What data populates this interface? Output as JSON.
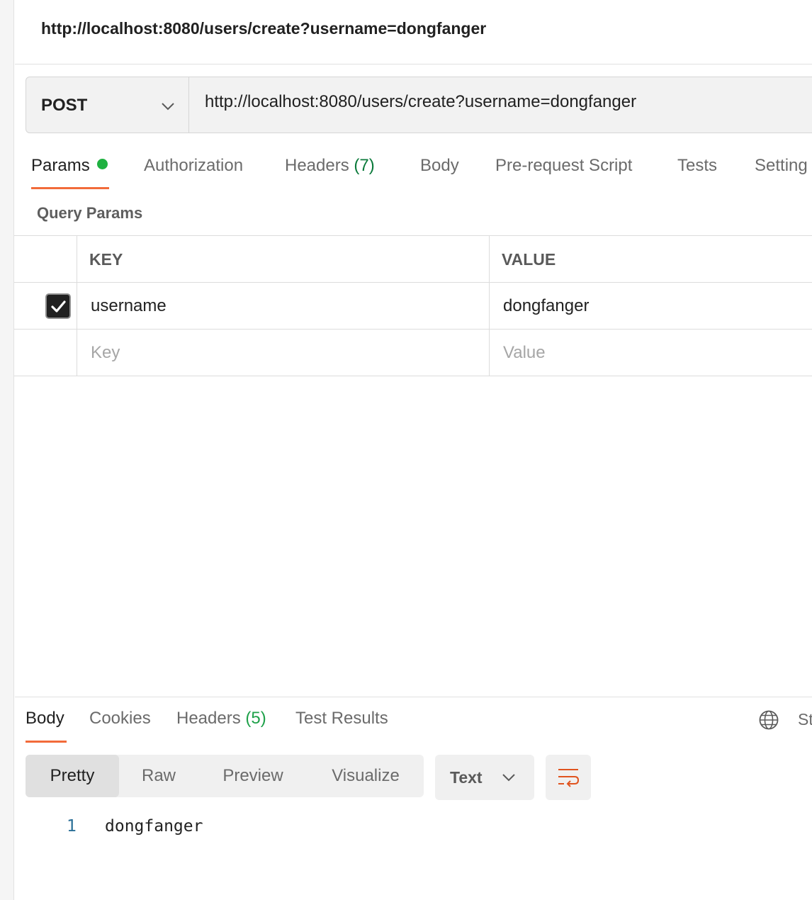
{
  "request": {
    "title": "http://localhost:8080/users/create?username=dongfanger",
    "method": "POST",
    "url": "http://localhost:8080/users/create?username=dongfanger"
  },
  "request_tabs": [
    {
      "label": "Params",
      "active": true,
      "has_indicator": true
    },
    {
      "label": "Authorization"
    },
    {
      "label": "Headers",
      "count": "(7)"
    },
    {
      "label": "Body"
    },
    {
      "label": "Pre-request Script"
    },
    {
      "label": "Tests"
    },
    {
      "label": "Setting"
    }
  ],
  "params": {
    "section_title": "Query Params",
    "columns": {
      "key": "KEY",
      "value": "VALUE"
    },
    "rows": [
      {
        "checked": true,
        "key": "username",
        "value": "dongfanger"
      }
    ],
    "empty_row": {
      "key_placeholder": "Key",
      "value_placeholder": "Value"
    }
  },
  "response": {
    "tabs": [
      {
        "label": "Body",
        "active": true
      },
      {
        "label": "Cookies"
      },
      {
        "label": "Headers",
        "count": "(5)"
      },
      {
        "label": "Test Results"
      }
    ],
    "status_cut": "St",
    "view_modes": [
      "Pretty",
      "Raw",
      "Preview",
      "Visualize"
    ],
    "active_view": "Pretty",
    "format": "Text",
    "body_lines": [
      {
        "number": "1",
        "text": "dongfanger"
      }
    ]
  },
  "colors": {
    "accent": "#f26b3a",
    "indicator": "#1fb141",
    "count_request": "#0b7a3b",
    "count_response": "#1fa14a",
    "line_number": "#2a6f97"
  }
}
